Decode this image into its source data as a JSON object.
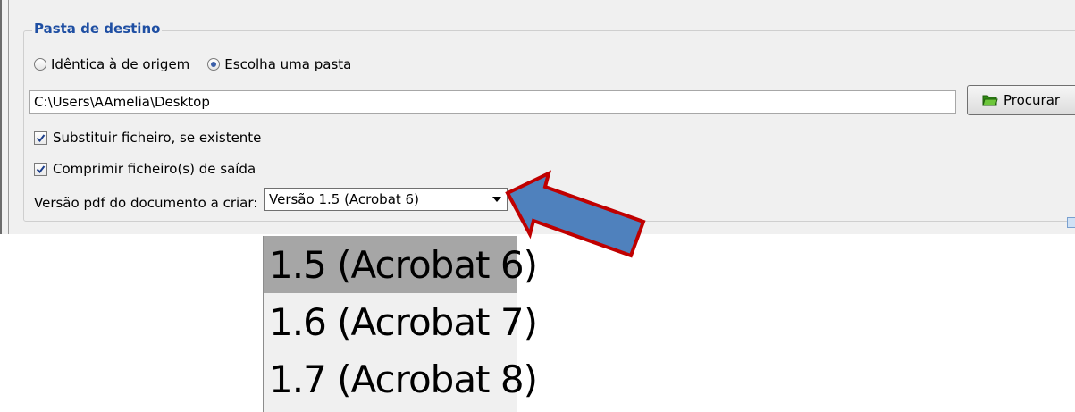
{
  "group": {
    "title": "Pasta de destino"
  },
  "destination": {
    "options": [
      {
        "label": "Idêntica à de origem",
        "selected": false
      },
      {
        "label": "Escolha uma pasta",
        "selected": true
      }
    ]
  },
  "path": {
    "value": "C:\\Users\\AAmelia\\Desktop"
  },
  "browse": {
    "label": "Procurar",
    "icon": "folder-open-icon",
    "icon_color": "#3da11b"
  },
  "options": {
    "overwrite": {
      "label": "Substituir ficheiro, se existente",
      "checked": true
    },
    "compress": {
      "label": "Comprimir ficheiro(s) de saída",
      "checked": true
    }
  },
  "pdf_version": {
    "label": "Versão pdf do documento a criar:",
    "selected": "Versão 1.5 (Acrobat 6)",
    "list": [
      "1.5 (Acrobat 6)",
      "1.6 (Acrobat 7)",
      "1.7 (Acrobat 8)"
    ],
    "highlighted_index": 0
  },
  "annotation": {
    "arrow_fill": "#4f81bd",
    "arrow_outline": "#c00000"
  },
  "colors": {
    "group_title": "#1f4fa3",
    "panel_bg": "#f0f0f0"
  }
}
